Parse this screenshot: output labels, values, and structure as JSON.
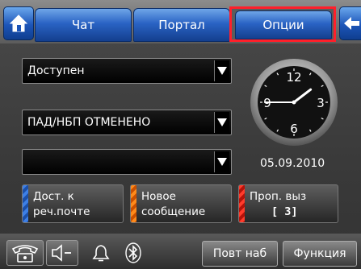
{
  "tabs": [
    {
      "label": "Чат"
    },
    {
      "label": "Портал"
    },
    {
      "label": "Опции",
      "selected": true
    }
  ],
  "dropdowns": {
    "status": {
      "value": "Доступен"
    },
    "pad": {
      "value": "ПАД/НБП ОТМЕНЕНО"
    },
    "empty": {
      "value": ""
    }
  },
  "clock": {
    "numerals": [
      "12",
      "3",
      "6",
      "9"
    ],
    "time": "01:45"
  },
  "date": "05.09.2010",
  "info_buttons": {
    "voicemail": {
      "line1": "Дост. к",
      "line2": "реч.почте"
    },
    "new_message": {
      "line1": "Новое",
      "line2": "сообщение"
    },
    "missed": {
      "line1": "Проп. выз",
      "line2": "[ 3]"
    }
  },
  "softkeys": {
    "redial": "Повт наб",
    "function": "Функция"
  },
  "colors": {
    "tab_blue": "#2a63c4",
    "selection_outline": "#ff1f2a",
    "stripe_blue": "#3d7fe6",
    "stripe_orange": "#ff8a1a",
    "stripe_red": "#ff3b2b"
  },
  "icons": [
    "home-icon",
    "back-arrow-icon",
    "dropdown-arrow-icon",
    "phone-icon",
    "speaker-icon",
    "bell-icon",
    "bluetooth-icon"
  ]
}
